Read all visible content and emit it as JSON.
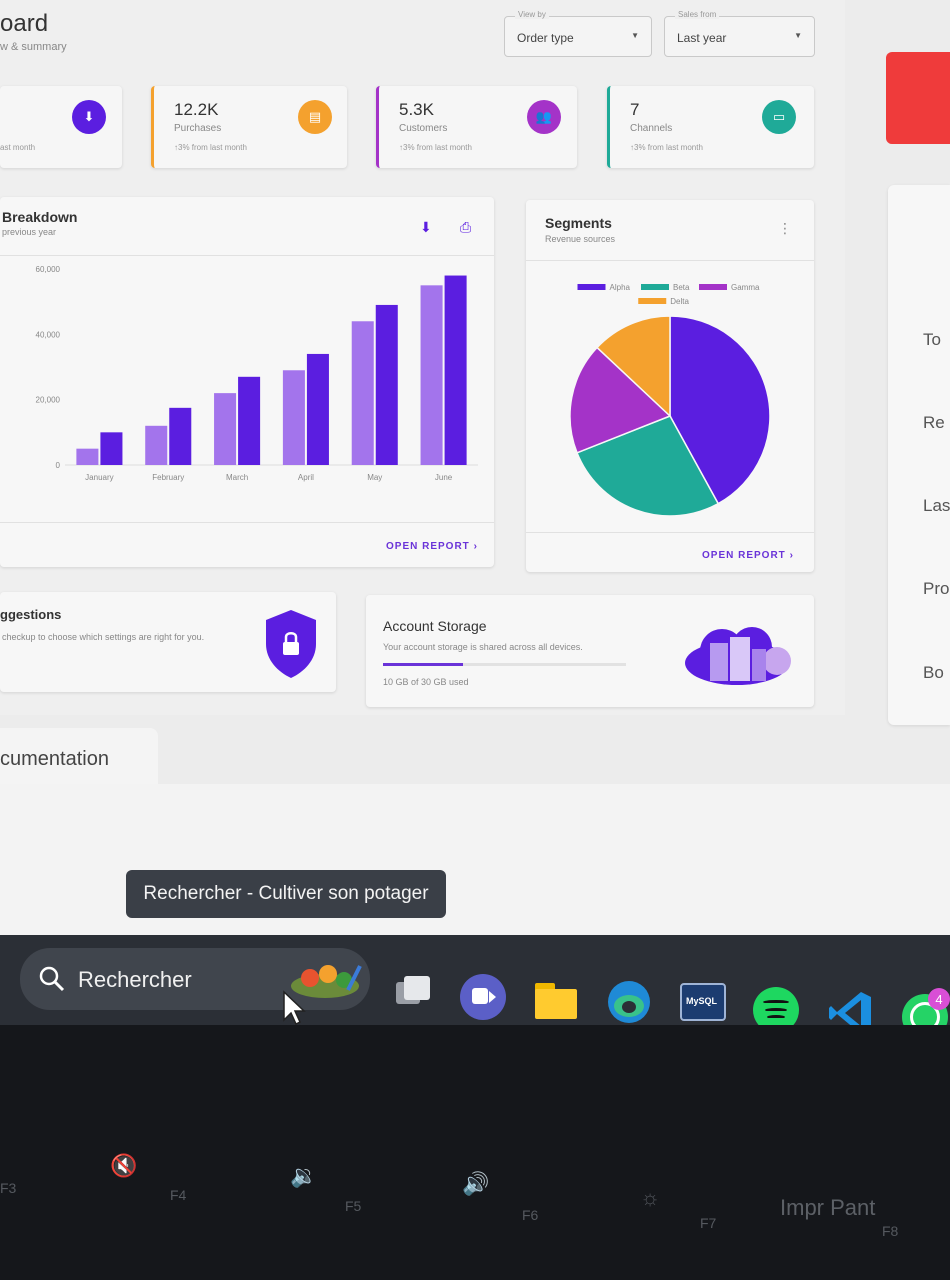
{
  "header": {
    "title": "oard",
    "subtitle": "w & summary",
    "view_by": {
      "legend": "View by",
      "value": "Order type"
    },
    "sales_from": {
      "legend": "Sales from",
      "value": "Last year"
    }
  },
  "stats": [
    {
      "number": "",
      "label": "",
      "trend": "ast month",
      "icon": "download-icon",
      "color": "#5b1ee0"
    },
    {
      "number": "12.2K",
      "label": "Purchases",
      "trend": "↑3%  from last month",
      "icon": "store-icon",
      "color": "#f4a12e"
    },
    {
      "number": "5.3K",
      "label": "Customers",
      "trend": "↑3%  from last month",
      "icon": "people-icon",
      "color": "#a433c8"
    },
    {
      "number": "7",
      "label": "Channels",
      "trend": "↑3%  from last month",
      "icon": "devices-icon",
      "color": "#1faa98"
    }
  ],
  "breakdown": {
    "title": "Breakdown",
    "subtitle": "previous year",
    "open_report": "OPEN REPORT  ›"
  },
  "segments": {
    "title": "Segments",
    "subtitle": "Revenue sources",
    "open_report": "OPEN REPORT  ›"
  },
  "chart_data": [
    {
      "type": "bar",
      "categories": [
        "January",
        "February",
        "March",
        "April",
        "May",
        "June"
      ],
      "series": [
        {
          "values": [
            5000,
            12000,
            22000,
            29000,
            44000,
            55000
          ],
          "color": "#a374ec"
        },
        {
          "values": [
            10000,
            17500,
            27000,
            34000,
            49000,
            58000
          ],
          "color": "#5b1ee0"
        }
      ],
      "yticks": [
        "0",
        "20,000",
        "40,000",
        "60,000"
      ],
      "ylim": [
        0,
        60000
      ]
    },
    {
      "type": "pie",
      "series": [
        {
          "name": "Alpha",
          "value": 42,
          "color": "#5b1ee0"
        },
        {
          "name": "Beta",
          "value": 27,
          "color": "#1faa98"
        },
        {
          "name": "Gamma",
          "value": 18,
          "color": "#a433c8"
        },
        {
          "name": "Delta",
          "value": 13,
          "color": "#f4a12e"
        }
      ]
    }
  ],
  "suggestions": {
    "title": "ggestions",
    "text": "checkup to choose which settings are right for you."
  },
  "storage": {
    "title": "Account Storage",
    "text": "Your account storage is shared across all devices.",
    "used_label": "10 GB of 30 GB used",
    "used_fraction": 0.33
  },
  "right_panel": {
    "items": [
      "To",
      "Re",
      "Las",
      "Pro",
      "Bo"
    ]
  },
  "doc_tab": "cumentation",
  "taskbar": {
    "search_placeholder": "Rechercher",
    "tooltip": "Rechercher - Cultiver son potager",
    "whatsapp_badge": "4",
    "mysql_label": "MySQL"
  },
  "keyboard": {
    "keys": [
      "F3",
      "F4",
      "F5",
      "F6",
      "F7",
      "Impr Pant",
      "F8"
    ]
  }
}
